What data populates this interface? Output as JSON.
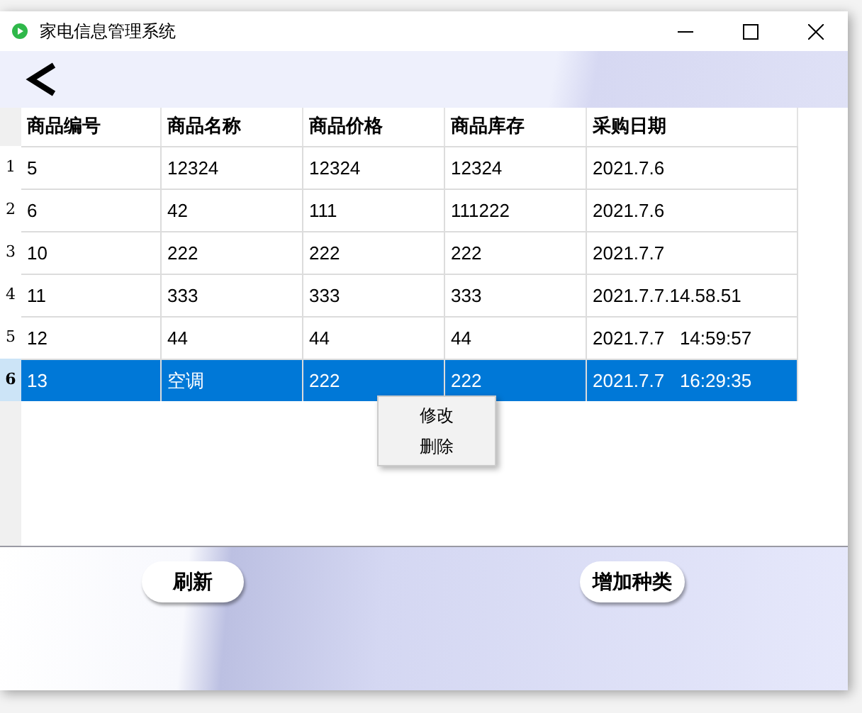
{
  "window": {
    "title": "家电信息管理系统"
  },
  "table": {
    "columns": [
      "商品编号",
      "商品名称",
      "商品价格",
      "商品库存",
      "采购日期"
    ],
    "rows": [
      {
        "number": "1",
        "selected": false,
        "cells": [
          "5",
          "12324",
          "12324",
          "12324",
          "2021.7.6"
        ]
      },
      {
        "number": "2",
        "selected": false,
        "cells": [
          "6",
          "42",
          "111",
          "111222",
          "2021.7.6"
        ]
      },
      {
        "number": "3",
        "selected": false,
        "cells": [
          "10",
          "222",
          "222",
          "222",
          "2021.7.7"
        ]
      },
      {
        "number": "4",
        "selected": false,
        "cells": [
          "11",
          "333",
          "333",
          "333",
          "2021.7.7.14.58.51"
        ]
      },
      {
        "number": "5",
        "selected": false,
        "cells": [
          "12",
          "44",
          "44",
          "44",
          "2021.7.7   14:59:57"
        ]
      },
      {
        "number": "6",
        "selected": true,
        "cells": [
          "13",
          "空调",
          "222",
          "222",
          "2021.7.7   16:29:35"
        ]
      }
    ]
  },
  "context_menu": {
    "items": [
      "修改",
      "删除"
    ]
  },
  "buttons": [
    "刷新",
    "增加种类"
  ]
}
